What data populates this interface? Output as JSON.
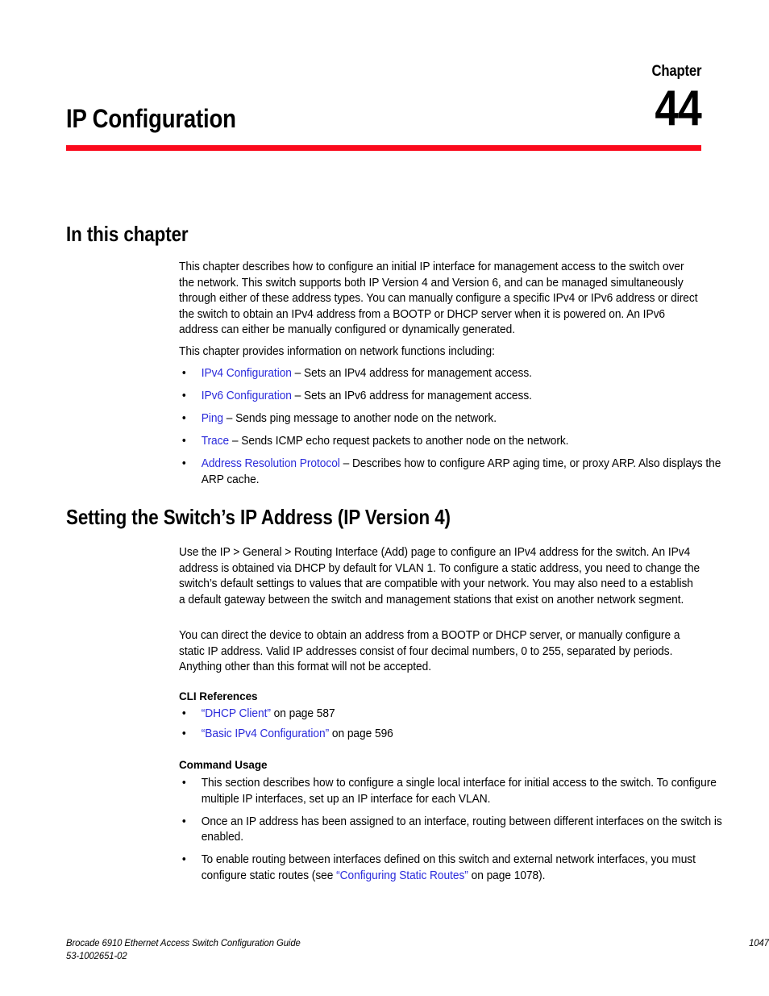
{
  "header": {
    "chapter_word": "Chapter",
    "chapter_number": "44",
    "chapter_title": "IP Configuration",
    "rule_color": "#fb0a1c"
  },
  "link_color": "#2b2bdb",
  "sections": {
    "in_this_chapter": {
      "heading": "In this chapter",
      "paragraph_1": "This chapter describes how to configure an initial IP interface for management access to the switch over the network. This switch supports both IP Version 4 and Version 6, and can be managed simultaneously through either of these address types. You can manually configure a specific IPv4 or IPv6 address or direct the switch to obtain an IPv4 address from a BOOTP or DHCP server when it is powered on. An IPv6 address can either be manually configured or dynamically generated.",
      "paragraph_2": "This chapter provides information on network functions including:",
      "bullets": [
        {
          "link": "IPv4 Configuration",
          "text": " – Sets an IPv4 address for management access."
        },
        {
          "link": "IPv6 Configuration",
          "text": " – Sets an IPv6 address for management access."
        },
        {
          "link": "Ping",
          "text": " – Sends ping message to another node on the network."
        },
        {
          "link": "Trace",
          "text": " – Sends ICMP echo request packets to another node on the network."
        },
        {
          "link": "Address Resolution Protocol",
          "text": " – Describes how to configure ARP aging time, or proxy ARP. Also displays the ARP cache."
        }
      ]
    },
    "setting_ip_address": {
      "heading": "Setting the Switch’s IP Address (IP Version 4)",
      "paragraph_1": "Use the IP > General > Routing Interface (Add) page to configure an IPv4 address for the switch. An IPv4 address is obtained via DHCP by default for VLAN 1. To configure a static address, you need to change the switch’s default settings to values that are compatible with your network. You may also need to a establish a default gateway between the switch and management stations that exist on another network segment.",
      "paragraph_2": "You can direct the device to obtain an address from a BOOTP or DHCP server, or manually configure a static IP address. Valid IP addresses consist of four decimal numbers, 0 to 255, separated by periods. Anything other than this format will not be accepted.",
      "cli_references": {
        "heading": "CLI References",
        "items": [
          {
            "link": "“DHCP Client”",
            "text": " on page 587"
          },
          {
            "link": "“Basic IPv4 Configuration”",
            "text": " on page 596"
          }
        ]
      },
      "command_usage": {
        "heading": "Command Usage",
        "items": [
          {
            "text": "This section describes how to configure a single local interface for initial access to the switch. To configure multiple IP interfaces, set up an IP interface for each VLAN."
          },
          {
            "text": "Once an IP address has been assigned to an interface, routing between different interfaces on the switch is enabled."
          },
          {
            "text_before": "To enable routing between interfaces defined on this switch and external network interfaces, you must configure static routes (see ",
            "link": "“Configuring Static Routes”",
            "text_after": " on page 1078)."
          }
        ]
      }
    }
  },
  "footer": {
    "guide_title": "Brocade 6910 Ethernet Access Switch Configuration Guide",
    "document_number": "53-1002651-02",
    "page_number": "1047"
  }
}
